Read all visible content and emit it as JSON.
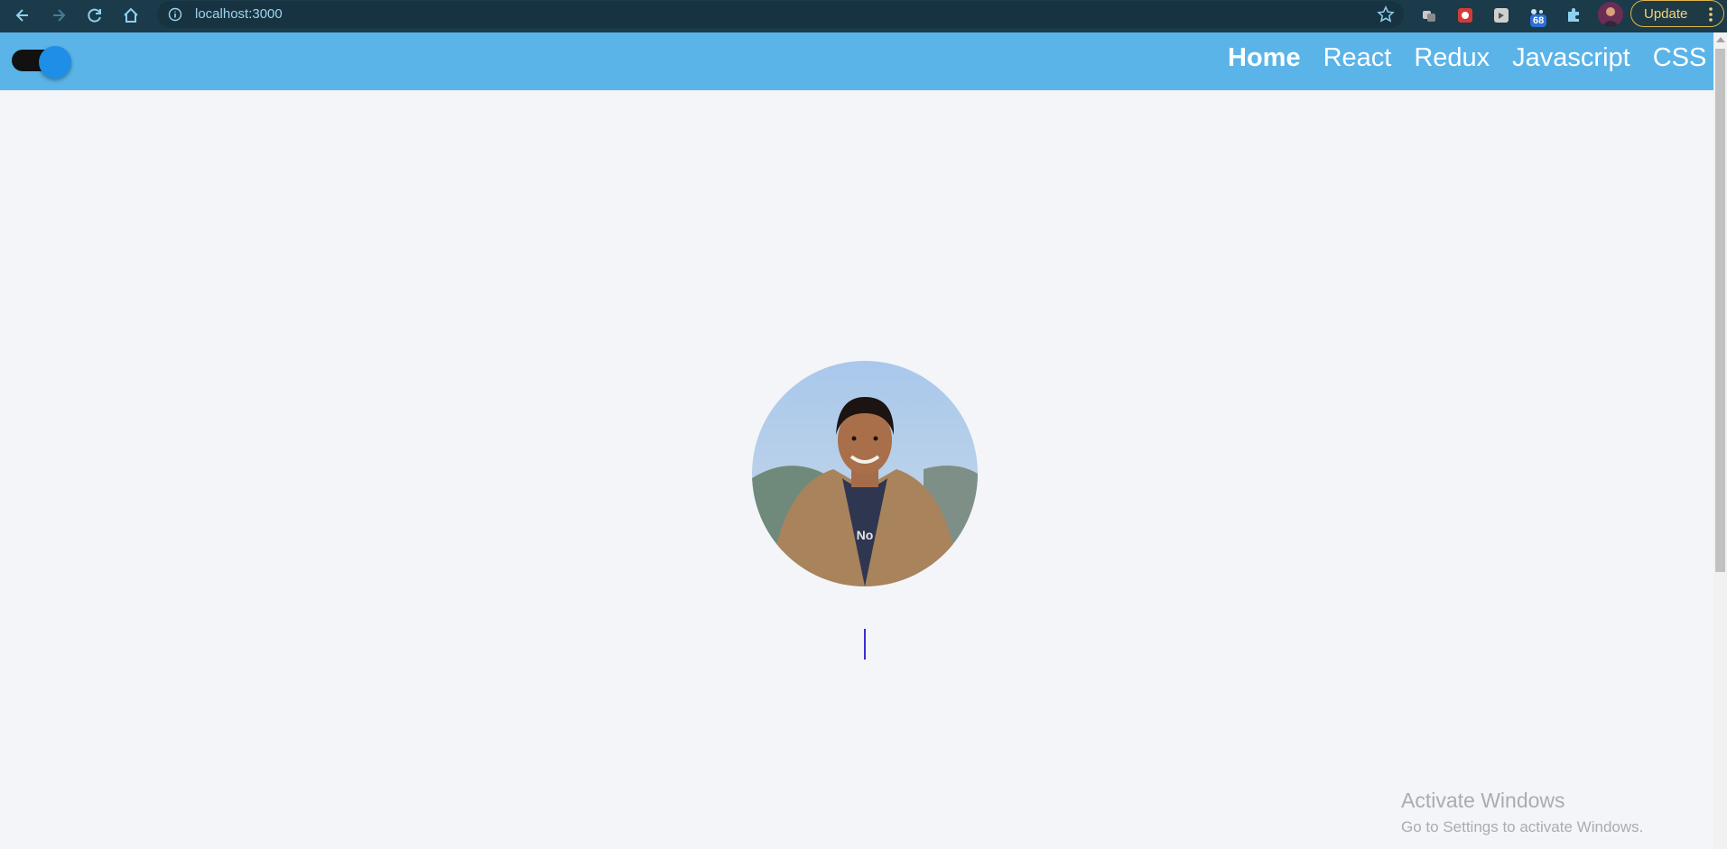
{
  "browser": {
    "url": "localhost:3000",
    "extension_badge": "68",
    "update_label": "Update"
  },
  "nav": {
    "items": [
      {
        "label": "Home",
        "active": true
      },
      {
        "label": "React",
        "active": false
      },
      {
        "label": "Redux",
        "active": false
      },
      {
        "label": "Javascript",
        "active": false
      },
      {
        "label": "CSS",
        "active": false
      }
    ]
  },
  "theme_toggle": {
    "state": "on",
    "color": "#1e8ee6"
  },
  "colors": {
    "header": "#5ab4e8",
    "background": "#f3f5f9",
    "cursor": "#3a2fd0"
  },
  "watermark": {
    "title": "Activate Windows",
    "subtitle": "Go to Settings to activate Windows."
  }
}
